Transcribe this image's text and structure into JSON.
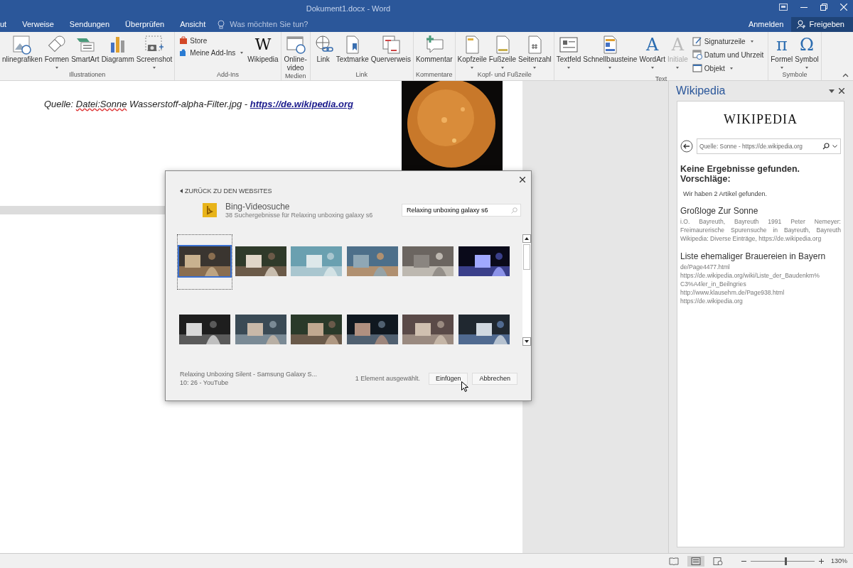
{
  "window": {
    "title": "Dokument1.docx - Word"
  },
  "tabs": [
    {
      "label": "ut"
    },
    {
      "label": "Verweise"
    },
    {
      "label": "Sendungen"
    },
    {
      "label": "Überprüfen"
    },
    {
      "label": "Ansicht"
    }
  ],
  "tell_me": {
    "placeholder": "Was möchten Sie tun?"
  },
  "account": {
    "sign_in": "Anmelden",
    "share": "Freigeben"
  },
  "ribbon": [
    {
      "label": "Illustrationen",
      "buttons": [
        {
          "label": "nlinegrafiken",
          "caret": false
        },
        {
          "label": "Formen",
          "caret": true
        },
        {
          "label": "SmartArt",
          "caret": false
        },
        {
          "label": "Diagramm",
          "caret": false
        },
        {
          "label": "Screenshot",
          "caret": true
        }
      ]
    },
    {
      "label": "Add-Ins",
      "small": [
        {
          "label": "Store",
          "caret": false
        },
        {
          "label": "Meine Add-Ins",
          "caret": true
        }
      ],
      "buttons": [
        {
          "label": "Wikipedia",
          "caret": false,
          "glyph": "W"
        }
      ]
    },
    {
      "label": "Medien",
      "buttons": [
        {
          "label": "Online-video",
          "caret": false
        }
      ]
    },
    {
      "label": "Link",
      "buttons": [
        {
          "label": "Link",
          "caret": false
        },
        {
          "label": "Textmarke",
          "caret": false
        },
        {
          "label": "Querverweis",
          "caret": false
        }
      ]
    },
    {
      "label": "Kommentare",
      "buttons": [
        {
          "label": "Kommentar",
          "caret": false
        }
      ]
    },
    {
      "label": "Kopf- und Fußzeile",
      "buttons": [
        {
          "label": "Kopfzeile",
          "caret": true
        },
        {
          "label": "Fußzeile",
          "caret": true
        },
        {
          "label": "Seitenzahl",
          "caret": true
        }
      ]
    },
    {
      "label": "Text",
      "buttons": [
        {
          "label": "Textfeld",
          "caret": true
        },
        {
          "label": "Schnellbausteine",
          "caret": true
        },
        {
          "label": "WordArt",
          "caret": true,
          "glyph": "A"
        },
        {
          "label": "Initiale",
          "caret": true,
          "glyph": "A",
          "disabled": true
        }
      ],
      "small": [
        {
          "label": "Signaturzeile",
          "caret": true
        },
        {
          "label": "Datum und Uhrzeit",
          "caret": false
        },
        {
          "label": "Objekt",
          "caret": true
        }
      ]
    },
    {
      "label": "Symbole",
      "buttons": [
        {
          "label": "Formel",
          "caret": true,
          "glyph": "π"
        },
        {
          "label": "Symbol",
          "caret": true,
          "glyph": "Ω"
        }
      ]
    }
  ],
  "document": {
    "caption_start": "Quelle: ",
    "caption_misspelled": "Datei:Sonne",
    "caption_middle": " Wasserstoff-alpha-Filter.jpg - ",
    "caption_link": "https://de.wikipedia.org",
    "photo": {
      "kind": "picture"
    }
  },
  "dialog": {
    "back_link": "ZURÜCK ZU DEN WEBSITES",
    "source_title": "Bing-Videosuche",
    "source_subtitle": "38 Suchergebnisse für Relaxing unboxing galaxy s6",
    "search": {
      "value": "Relaxing unboxing galaxy s6"
    },
    "thumbnails": [
      {
        "kind": "picture",
        "selected": true
      },
      {
        "kind": "picture",
        "selected": false
      },
      {
        "kind": "picture",
        "selected": false
      },
      {
        "kind": "picture",
        "selected": false
      },
      {
        "kind": "picture",
        "selected": false
      },
      {
        "kind": "picture",
        "selected": false
      },
      {
        "kind": "picture",
        "selected": false
      },
      {
        "kind": "picture",
        "selected": false
      },
      {
        "kind": "picture",
        "selected": false
      },
      {
        "kind": "picture",
        "selected": false
      },
      {
        "kind": "picture",
        "selected": false
      },
      {
        "kind": "picture",
        "selected": false
      }
    ],
    "selected_title": "Relaxing Unboxing Silent - Samsung Galaxy S...",
    "selected_meta": "10: 26 - YouTube",
    "selection_count": "1 Element ausgewählt.",
    "buttons": [
      "Einfügen",
      "Abbrechen"
    ]
  },
  "task_pane": {
    "title": "Wikipedia",
    "logo": "WIKIPEDIA",
    "search": {
      "value": "Quelle: Sonne - https://de.wikipedia.org"
    },
    "heading": "Keine Ergebnisse gefunden. Vorschläge:",
    "summary": "Wir haben 2 Artikel gefunden.",
    "results": [
      {
        "title": "Großloge Zur Sonne",
        "lines": [
          "i.O. Bayreuth, Bayreuth 1991 Peter Nemeyer: Freimaurerische Spurensuche in Bayreuth, Bayreuth Wikipedia: Diverse Einträge, https://de.wikipedia.org"
        ]
      },
      {
        "title": "Liste ehemaliger Brauereien in Bayern",
        "lines": [
          "de/Page4477.html",
          "https://de.wikipedia.org/wiki/Liste_der_Baudenkm%",
          "C3%A4ler_in_Beilngries",
          "http://www.klausehm.de/Page938.html",
          "https://de.wikipedia.org"
        ]
      }
    ]
  },
  "status_bar": {
    "zoom": {
      "level": 0.55
    },
    "zoom_reading": "130%"
  }
}
